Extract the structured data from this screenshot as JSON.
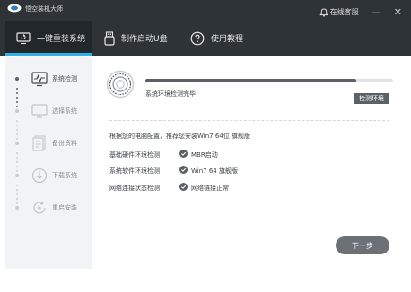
{
  "app": {
    "title": "悟空装机大师",
    "online_service": "在线客服",
    "minimize_glyph": "—",
    "close_glyph": "✕"
  },
  "tabs": [
    {
      "label": "一键重装系统",
      "icon": "monitor-reinstall-icon",
      "active": true
    },
    {
      "label": "制作启动U盘",
      "icon": "usb-drive-icon",
      "active": false
    },
    {
      "label": "使用教程",
      "icon": "help-question-icon",
      "active": false
    }
  ],
  "steps": [
    {
      "label": "系统检测",
      "icon": "pulse-monitor-icon",
      "active": true
    },
    {
      "label": "选择系统",
      "icon": "monitor-icon",
      "active": false
    },
    {
      "label": "备份资料",
      "icon": "document-backup-icon",
      "active": false
    },
    {
      "label": "下载系统",
      "icon": "download-circle-icon",
      "active": false
    },
    {
      "label": "重启安装",
      "icon": "restart-install-icon",
      "active": false
    }
  ],
  "detection": {
    "progress": 0.85,
    "status": "系统环境检测完毕！",
    "env_button": "检测环境",
    "recommendation": "根据您的电脑配置，推荐您安装Win7 64位 旗舰版",
    "checks": [
      {
        "label": "基础硬件环境检测",
        "value": "MBR启动"
      },
      {
        "label": "系统软件环境检测",
        "value": "Win7 64 旗舰版"
      },
      {
        "label": "网络连接状态检测",
        "value": "网络链接正常"
      }
    ]
  },
  "footer": {
    "next_button": "下一步"
  },
  "colors": {
    "header_bg": "#2e3337",
    "tab_accent": "#31b0e7",
    "sidebar_bg": "#f2f3f5",
    "button_bg": "#5c6166"
  }
}
